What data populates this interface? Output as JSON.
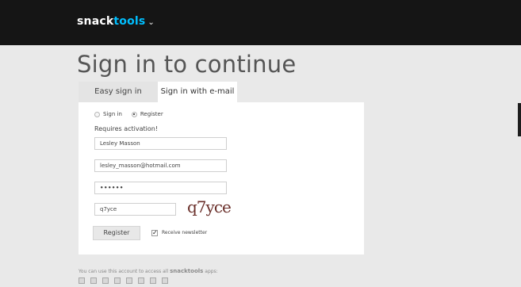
{
  "brand": {
    "snack": "snack",
    "tools": "tools",
    "chevron": "⌄"
  },
  "heading": "Sign in to continue",
  "tabs": [
    {
      "label": "Easy sign in",
      "active": false
    },
    {
      "label": "Sign in with e-mail",
      "active": true
    }
  ],
  "form": {
    "radio_signin": "Sign in",
    "radio_register": "Register",
    "selected_radio": "Register",
    "notice": "Requires activation!",
    "name_value": "Lesley Masson",
    "email_value": "lesley_masson@hotmail.com",
    "password_mask": "••••••",
    "captcha_value": "q7yce",
    "captcha_image_text": "q7yce",
    "register_label": "Register",
    "newsletter_checked": true,
    "newsletter_label": "Receive newsletter"
  },
  "footer": {
    "text_before": "You can use this account to access all",
    "brand": "snacktools",
    "text_after": "apps:",
    "app_icons": [
      "app-icon-1",
      "app-icon-2",
      "app-icon-3",
      "app-icon-4",
      "app-icon-5",
      "app-icon-6",
      "app-icon-7",
      "app-icon-8"
    ]
  },
  "colors": {
    "tools_accent": "#00bfff",
    "topbar": "#151515",
    "captcha_text": "#6a2f2a"
  }
}
